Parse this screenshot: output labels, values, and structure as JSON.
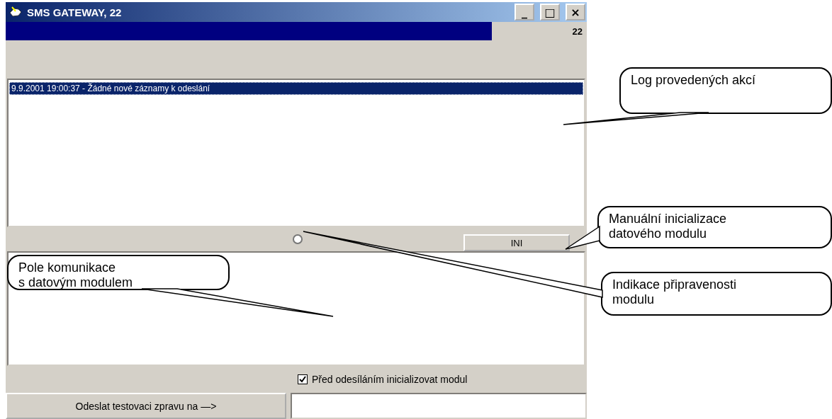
{
  "window": {
    "title": "SMS GATEWAY, 22",
    "controls": [
      "_",
      "□",
      "×"
    ]
  },
  "progress": {
    "level": 0.865,
    "reading": "22"
  },
  "log": {
    "items": [
      {
        "text": "9.9.2001 19:00:37 - Žádné nové záznamy k odeslání",
        "selected": true
      }
    ]
  },
  "ready_indicator": {
    "selected": false
  },
  "ini_button": "INI",
  "init_checkbox": {
    "label": "Před odesíláním inicializovat modul",
    "checked": true
  },
  "send_button": "Odeslat testovaci zpravu na —>",
  "callouts": [
    {
      "lines": [
        "Log provedených akcí"
      ]
    },
    {
      "lines": [
        "Manuální inicializace",
        "datového modulu"
      ]
    },
    {
      "lines": [
        "Pole komunikace",
        "s datovým modulem"
      ]
    },
    {
      "lines": [
        "Indikace připravenosti",
        "modulu"
      ]
    }
  ]
}
